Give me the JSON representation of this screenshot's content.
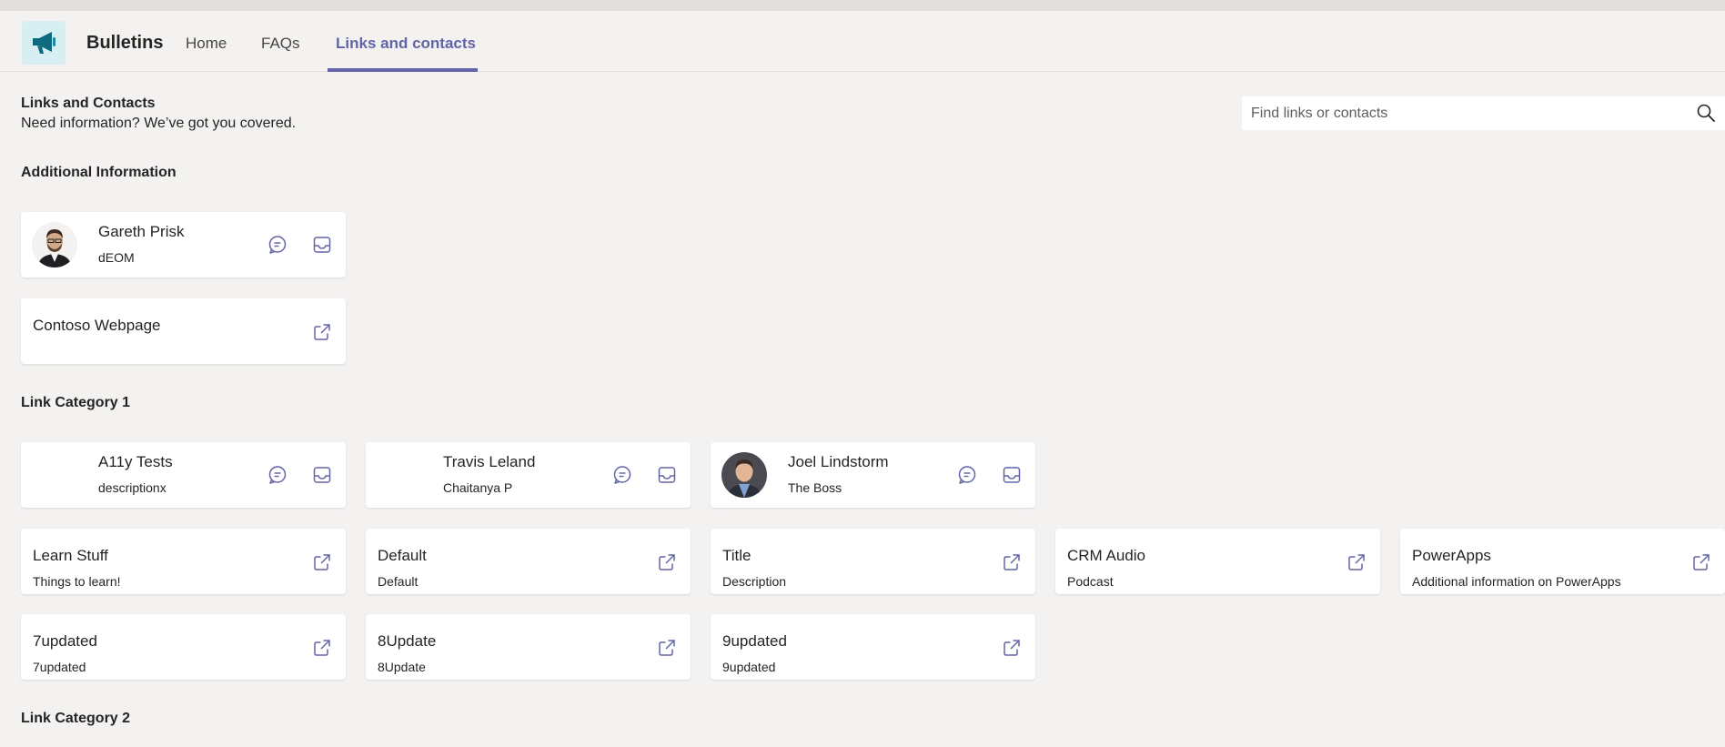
{
  "app": {
    "name": "Bulletins",
    "icon": "megaphone-icon"
  },
  "tabs": [
    {
      "label": "Home"
    },
    {
      "label": "FAQs"
    },
    {
      "label": "Links and contacts",
      "active": true
    }
  ],
  "page": {
    "heading": "Links and Contacts",
    "subheading": "Need information? We’ve got you covered."
  },
  "search": {
    "placeholder": "Find links or contacts",
    "value": ""
  },
  "colors": {
    "accent": "#6264a7",
    "background": "#f3f2f1",
    "card": "#ffffff"
  },
  "sections": [
    {
      "title": "Additional Information",
      "contacts": [
        {
          "name": "Gareth Prisk",
          "description": "dEOM",
          "has_photo": true
        }
      ],
      "links": [
        {
          "title": "Contoso Webpage",
          "description": ""
        }
      ]
    },
    {
      "title": "Link Category 1",
      "contacts": [
        {
          "name": "A11y Tests",
          "description": "descriptionx",
          "has_photo": false
        },
        {
          "name": "Travis Leland",
          "description": "Chaitanya P",
          "has_photo": false
        },
        {
          "name": "Joel Lindstorm",
          "description": "The Boss",
          "has_photo": true
        }
      ],
      "links": [
        {
          "title": "Learn Stuff",
          "description": "Things to learn!"
        },
        {
          "title": "Default",
          "description": "Default"
        },
        {
          "title": "Title",
          "description": "Description"
        },
        {
          "title": "CRM Audio",
          "description": "Podcast"
        },
        {
          "title": "PowerApps",
          "description": "Additional information on PowerApps"
        },
        {
          "title": "7updated",
          "description": "7updated"
        },
        {
          "title": "8Update",
          "description": "8Update"
        },
        {
          "title": "9updated",
          "description": "9updated"
        }
      ]
    },
    {
      "title": "Link Category 2"
    }
  ]
}
